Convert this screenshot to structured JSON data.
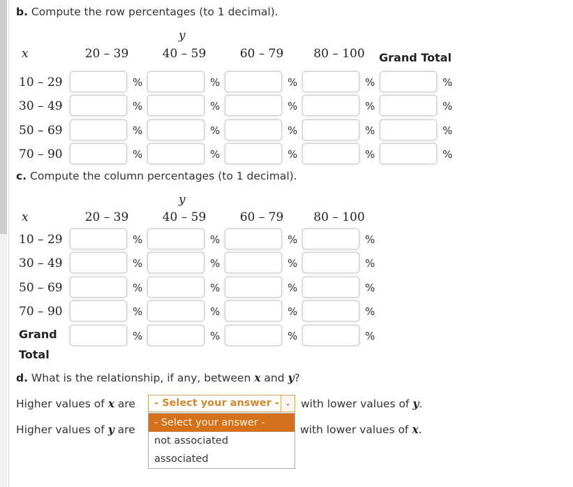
{
  "part_b": {
    "prefix": "b.",
    "text": "Compute the row percentages (to 1 decimal).",
    "y_label": "y",
    "x_label": "x",
    "columns": [
      "20 – 39",
      "40 – 59",
      "60 – 79",
      "80 – 100"
    ],
    "grand_total_header": "Grand Total",
    "rows": [
      "10 – 29",
      "30 – 49",
      "50 – 69",
      "70 – 90"
    ],
    "unit": "%",
    "values": [
      [
        "",
        "",
        "",
        "",
        ""
      ],
      [
        "",
        "",
        "",
        "",
        ""
      ],
      [
        "",
        "",
        "",
        "",
        ""
      ],
      [
        "",
        "",
        "",
        "",
        ""
      ]
    ]
  },
  "part_c": {
    "prefix": "c.",
    "text": "Compute the column percentages (to 1 decimal).",
    "y_label": "y",
    "x_label": "x",
    "columns": [
      "20 – 39",
      "40 – 59",
      "60 – 79",
      "80 – 100"
    ],
    "rows": [
      "10 – 29",
      "30 – 49",
      "50 – 69",
      "70 – 90"
    ],
    "grand_total_label_1": "Grand",
    "grand_total_label_2": "Total",
    "unit": "%"
  },
  "part_d": {
    "prefix": "d.",
    "text_before": "What is the relationship, if any, between",
    "var_x": "x",
    "and": "and",
    "var_y": "y",
    "qmark": "?",
    "line1": {
      "before": "Higher values of",
      "var": "x",
      "are": "are",
      "after": "with lower values of",
      "var2": "y",
      "end": "."
    },
    "line2": {
      "before": "Higher values of",
      "var": "y",
      "are": "are",
      "after": "with lower values of",
      "var2": "x",
      "end": "."
    },
    "select": {
      "selected": "- Select your answer -",
      "options": [
        "- Select your answer -",
        "not associated",
        "associated"
      ],
      "arrow": "⌄"
    }
  },
  "colors": {
    "accent": "#d4711a",
    "select_text": "#d08a2c"
  }
}
